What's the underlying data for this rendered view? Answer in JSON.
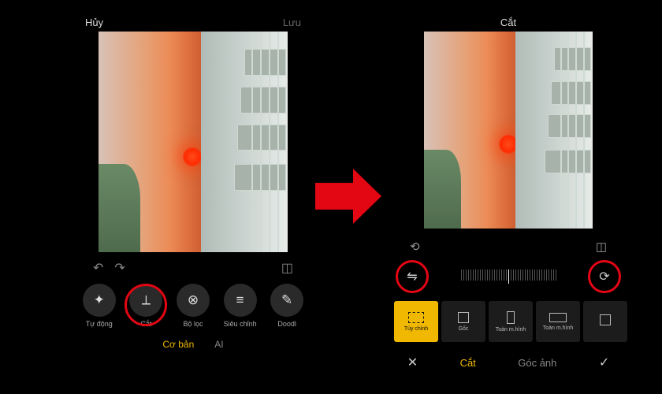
{
  "left": {
    "header": {
      "cancel": "Hủy",
      "save": "Lưu"
    },
    "tools": [
      {
        "id": "auto",
        "name": "auto-tool",
        "label": "Tự động",
        "glyph": "✦"
      },
      {
        "id": "crop",
        "name": "crop-tool",
        "label": "Cắt",
        "glyph": "⟂",
        "highlight": true
      },
      {
        "id": "filter",
        "name": "filter-tool",
        "label": "Bộ lọc",
        "glyph": "⊗"
      },
      {
        "id": "adjust",
        "name": "adjust-tool",
        "label": "Siêu chỉnh",
        "glyph": "≡"
      },
      {
        "id": "doodle",
        "name": "doodle-tool",
        "label": "Doodl",
        "glyph": "✎"
      }
    ],
    "tabs": {
      "basic": "Cơ bản",
      "ai": "AI",
      "active": "basic"
    }
  },
  "right": {
    "header": {
      "title": "Cắt"
    },
    "slider": {
      "flip_label": "flip",
      "rotate_label": "rotate"
    },
    "aspects": [
      {
        "id": "free",
        "label": "Tùy chỉnh",
        "shape": "free",
        "active": true
      },
      {
        "id": "orig",
        "label": "Gốc",
        "shape": "sq"
      },
      {
        "id": "full",
        "label": "Toàn m.hình",
        "shape": "tall"
      },
      {
        "id": "wide",
        "label": "Toàn m.hình",
        "shape": "wide"
      },
      {
        "id": "more",
        "label": "",
        "shape": "sq"
      }
    ],
    "confirm": {
      "cancel": "✕",
      "crop": "Cắt",
      "angle": "Góc ảnh",
      "ok": "✓",
      "active": "crop"
    }
  }
}
